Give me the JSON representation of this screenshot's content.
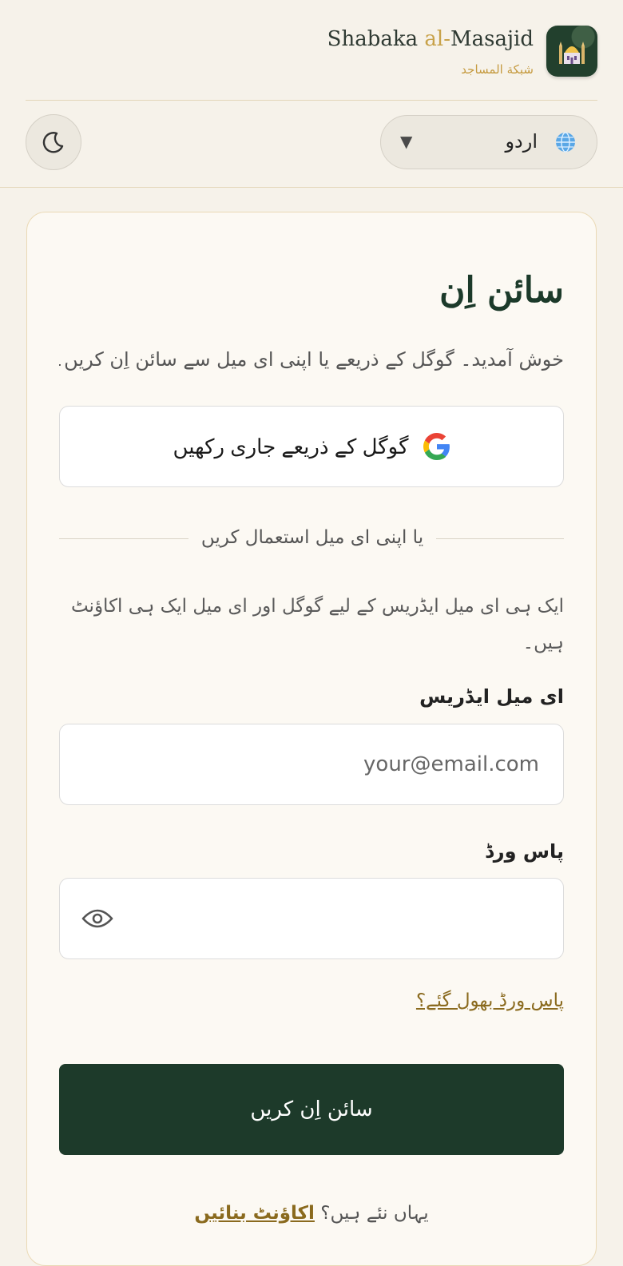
{
  "header": {
    "brand_prefix": "Shabaka ",
    "brand_accent": "al-",
    "brand_suffix": "Masajid",
    "brand_subtitle": "شبكة المساجد",
    "logo_icon": "mosque-icon"
  },
  "toolbar": {
    "theme_icon": "moon-icon",
    "language": {
      "selected": "اردو",
      "icon": "globe-icon"
    }
  },
  "signin": {
    "title": "سائن اِن",
    "subtitle": "خوش آمدید۔ گوگل کے ذریعے یا اپنی ای میل سے سائن اِن کریں۔",
    "google_button": "گوگل کے ذریعے جاری رکھیں",
    "divider": "یا اپنی ای میل استعمال کریں",
    "note": "ایک ہی ای میل ایڈریس کے لیے گوگل اور ای میل ایک ہی اکاؤنٹ ہیں۔",
    "email_label": "ای میل ایڈریس",
    "email_placeholder": "your@email.com",
    "email_value": "",
    "password_label": "پاس ورڈ",
    "password_value": "",
    "forgot_link": "پاس ورڈ بھول گئے؟",
    "submit_button": "سائن اِن کریں",
    "signup_prompt": "یہاں نئے ہیں؟",
    "signup_link": "اکاؤنٹ بنائیں"
  },
  "colors": {
    "primary": "#1d3a2a",
    "accent": "#c8a24a",
    "link": "#8a6a1e",
    "background": "#f6f2ea",
    "card": "#fcf9f3"
  }
}
